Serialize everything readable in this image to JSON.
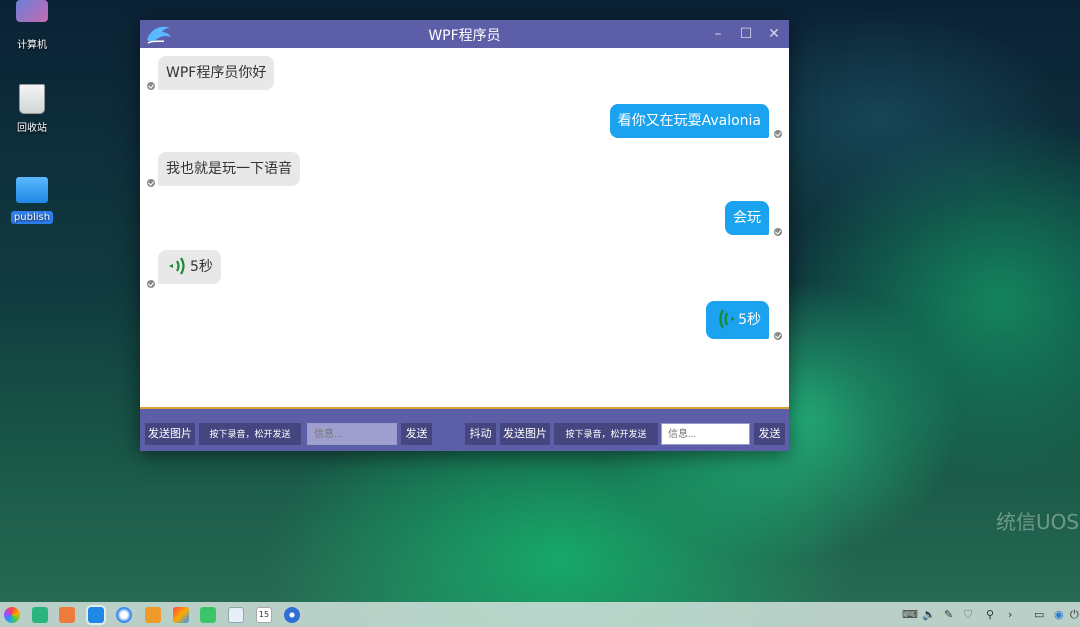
{
  "desktop": {
    "icons": [
      {
        "label": "计算机"
      },
      {
        "label": "回收站"
      },
      {
        "label": "publish"
      }
    ],
    "watermark": "统信UOS"
  },
  "window": {
    "title": "WPF程序员",
    "controls": {
      "minimize": "–",
      "maximize": "☐",
      "close": "✕"
    }
  },
  "messages": [
    {
      "side": "left",
      "text": "WPF程序员你好"
    },
    {
      "side": "right",
      "text": "看你又在玩耍Avalonia"
    },
    {
      "side": "left",
      "text": "我也就是玩一下语音"
    },
    {
      "side": "right",
      "text": "会玩"
    },
    {
      "side": "left",
      "voice": true,
      "text": "5秒"
    },
    {
      "side": "right",
      "voice": true,
      "text": "5秒"
    }
  ],
  "toolbar": {
    "left": {
      "send_image": "发送图片",
      "record": "按下录音，松开发送",
      "input_placeholder": "信息...",
      "send": "发送"
    },
    "right": {
      "shake": "抖动",
      "send_image": "发送图片",
      "record": "按下录音，松开发送",
      "input_placeholder": "信息...",
      "send": "发送"
    }
  },
  "taskbar": {
    "apps": [
      "launcher-icon",
      "multitask-icon",
      "app-store-icon",
      "file-manager-icon",
      "browser-icon",
      "store-icon",
      "photos-icon",
      "music-icon",
      "document-icon",
      "calendar-icon",
      "settings-icon"
    ],
    "calendar_day": "15",
    "tray": [
      "keyboard-icon",
      "volume-icon",
      "pen-icon",
      "shield-icon",
      "usb-icon",
      "expand-icon",
      "notification-icon",
      "network-icon",
      "power-icon"
    ]
  },
  "colors": {
    "titlebar": "#5d5ea8",
    "bubble_right": "#1ba3f0",
    "bubble_left": "#e8e8e8",
    "divider": "#e0a030"
  }
}
